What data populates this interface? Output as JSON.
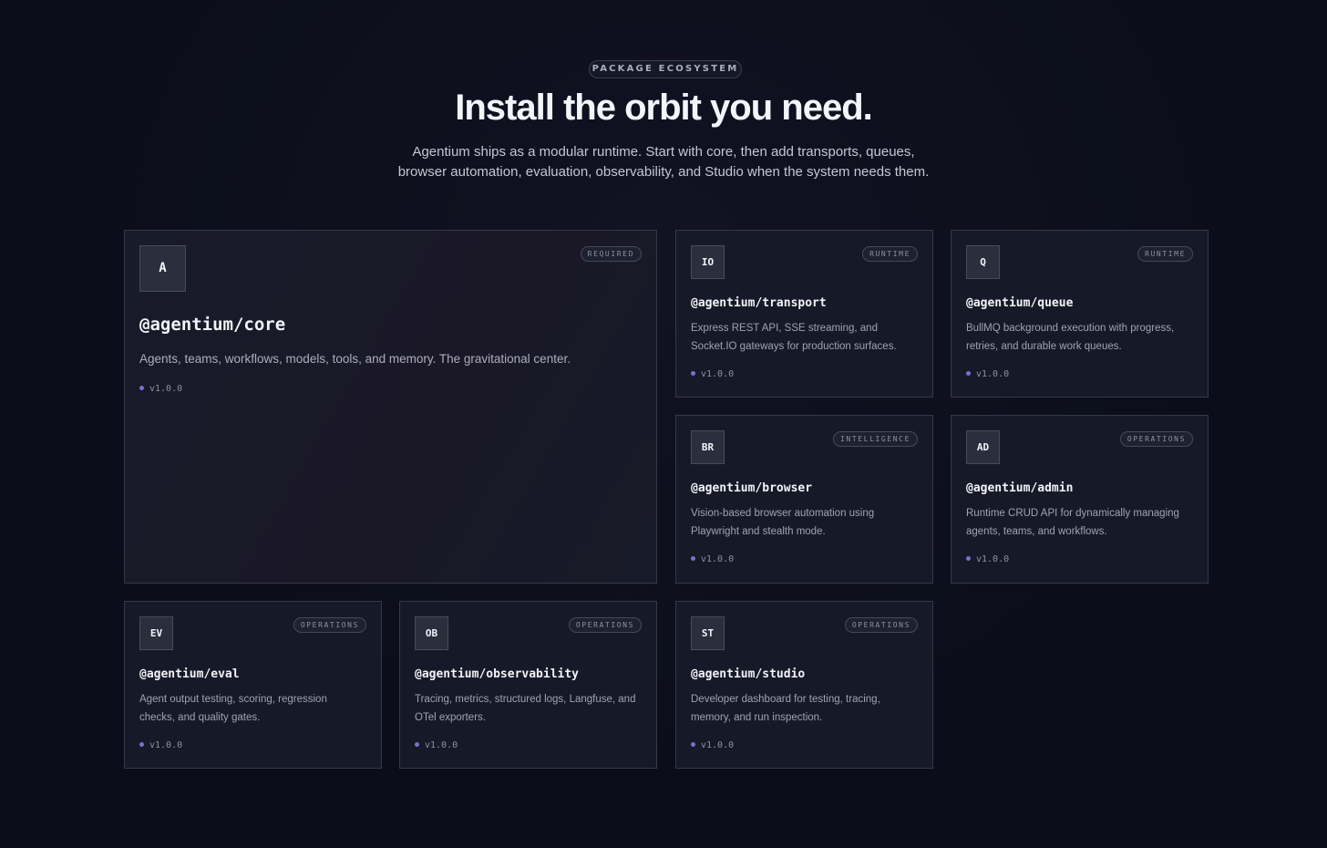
{
  "section": {
    "eyebrow": "PACKAGE ECOSYSTEM",
    "title": "Install the orbit you need.",
    "subtitle_line1": "Agentium ships as a modular runtime. Start with core, then add transports, queues,",
    "subtitle_line2": "browser automation, evaluation, observability, and Studio when the system needs them."
  },
  "colors": {
    "background": "#0b0e1a",
    "card": "#161a28",
    "card_border": "#343848",
    "version_dot": "#7a6fd0"
  },
  "packages": [
    {
      "icon": "A",
      "tag": "REQUIRED",
      "name": "@agentium/core",
      "description": "Agents, teams, workflows, models, tools, and memory. The gravitational center.",
      "version": "v1.0.0"
    },
    {
      "icon": "IO",
      "tag": "RUNTIME",
      "name": "@agentium/transport",
      "description": "Express REST API, SSE streaming, and Socket.IO gateways for production surfaces.",
      "version": "v1.0.0"
    },
    {
      "icon": "Q",
      "tag": "RUNTIME",
      "name": "@agentium/queue",
      "description": "BullMQ background execution with progress, retries, and durable work queues.",
      "version": "v1.0.0"
    },
    {
      "icon": "BR",
      "tag": "INTELLIGENCE",
      "name": "@agentium/browser",
      "description": "Vision-based browser automation using Playwright and stealth mode.",
      "version": "v1.0.0"
    },
    {
      "icon": "AD",
      "tag": "OPERATIONS",
      "name": "@agentium/admin",
      "description": "Runtime CRUD API for dynamically managing agents, teams, and workflows.",
      "version": "v1.0.0"
    },
    {
      "icon": "EV",
      "tag": "OPERATIONS",
      "name": "@agentium/eval",
      "description": "Agent output testing, scoring, regression checks, and quality gates.",
      "version": "v1.0.0"
    },
    {
      "icon": "OB",
      "tag": "OPERATIONS",
      "name": "@agentium/observability",
      "description": "Tracing, metrics, structured logs, Langfuse, and OTel exporters.",
      "version": "v1.0.0"
    },
    {
      "icon": "ST",
      "tag": "OPERATIONS",
      "name": "@agentium/studio",
      "description": "Developer dashboard for testing, tracing, memory, and run inspection.",
      "version": "v1.0.0"
    }
  ]
}
